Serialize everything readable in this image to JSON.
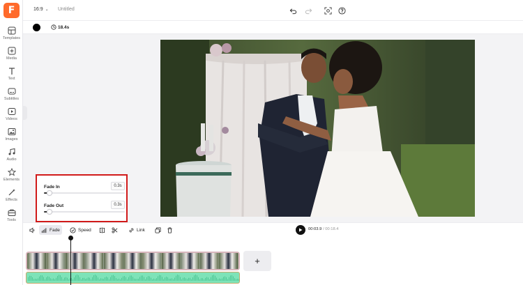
{
  "app": {
    "logo_letter": "F",
    "aspect_ratio": "16:9",
    "doc_title": "Untitled",
    "accent_color": "#ff6a2b"
  },
  "sidebar": {
    "items": [
      {
        "label": "Templates",
        "icon": "templates-icon"
      },
      {
        "label": "Media",
        "icon": "media-plus-icon"
      },
      {
        "label": "Text",
        "icon": "text-icon"
      },
      {
        "label": "Subtitles",
        "icon": "subtitles-icon"
      },
      {
        "label": "Videos",
        "icon": "video-icon"
      },
      {
        "label": "Images",
        "icon": "image-icon"
      },
      {
        "label": "Audio",
        "icon": "music-note-icon"
      },
      {
        "label": "Elements",
        "icon": "elements-icon"
      },
      {
        "label": "Effects",
        "icon": "effects-icon"
      },
      {
        "label": "Tools",
        "icon": "toolbox-icon"
      }
    ]
  },
  "topbar": {
    "icons": [
      "undo-icon",
      "redo-icon",
      "screenshot-icon",
      "help-icon"
    ]
  },
  "propbar": {
    "background_color": "#000000",
    "duration": "18.4s"
  },
  "fade_panel": {
    "fade_in": {
      "label": "Fade In",
      "value": "0.3s",
      "level": 0.05
    },
    "fade_out": {
      "label": "Fade Out",
      "value": "0.3s",
      "level": 0.05
    }
  },
  "timeline_toolbar": {
    "fade_label": "Fade",
    "speed_label": "Speed",
    "link_label": "Link",
    "current_time": "00:03.9",
    "total_time": "/ 00:18.4"
  },
  "timeline": {
    "add_label": "+",
    "thumbnail_count": 11
  }
}
